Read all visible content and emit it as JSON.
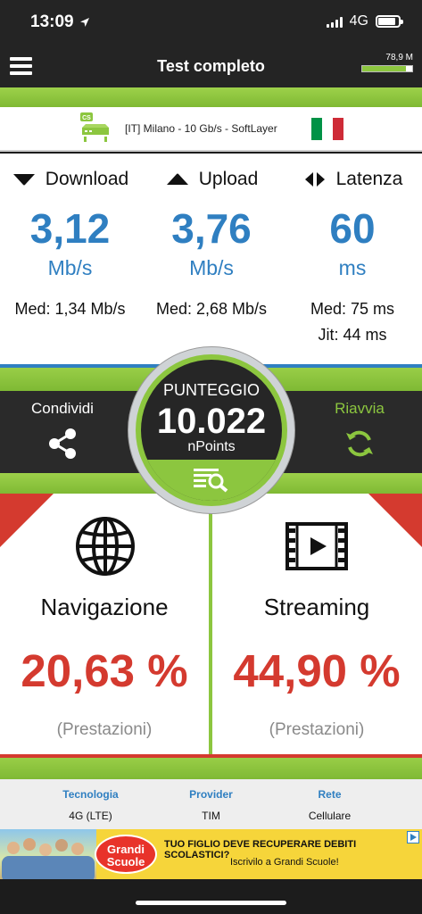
{
  "status_bar": {
    "time": "13:09",
    "network": "4G",
    "battery_level": 0.85
  },
  "header": {
    "title": "Test completo",
    "memory": "78,9 M",
    "memory_fraction": 0.88
  },
  "server": {
    "label": "[IT] Milano - 10 Gb/s - SoftLayer",
    "badge": "CS",
    "flag_colors": [
      "#009246",
      "#ffffff",
      "#ce2b37"
    ]
  },
  "metrics": {
    "download": {
      "label": "Download",
      "value": "3,12",
      "unit": "Mb/s",
      "med": "Med: 1,34 Mb/s"
    },
    "upload": {
      "label": "Upload",
      "value": "3,76",
      "unit": "Mb/s",
      "med": "Med: 2,68 Mb/s"
    },
    "latency": {
      "label": "Latenza",
      "value": "60",
      "unit": "ms",
      "med": "Med: 75 ms",
      "jit": "Jit: 44 ms"
    }
  },
  "actions": {
    "share": "Condividi",
    "restart": "Riavvia"
  },
  "score": {
    "label": "PUNTEGGIO",
    "value": "10.022",
    "unit": "nPoints"
  },
  "quality": {
    "browsing": {
      "label": "Navigazione",
      "value": "20,63 %",
      "sub": "(Prestazioni)"
    },
    "streaming": {
      "label": "Streaming",
      "value": "44,90 %",
      "sub": "(Prestazioni)"
    }
  },
  "info": {
    "technology": {
      "label": "Tecnologia",
      "value": "4G (LTE)"
    },
    "provider": {
      "label": "Provider",
      "value": "TIM"
    },
    "network": {
      "label": "Rete",
      "value": "Cellulare"
    }
  },
  "ad": {
    "brand": "Grandi Scuole",
    "headline": "TUO FIGLIO DEVE RECUPERARE DEBITI SCOLASTICI?",
    "cta": "Iscrivilo a Grandi Scuole!"
  },
  "colors": {
    "accent_green": "#8cc63f",
    "accent_blue": "#2f7fc1",
    "accent_red": "#d43a2f",
    "dark": "#242424"
  }
}
